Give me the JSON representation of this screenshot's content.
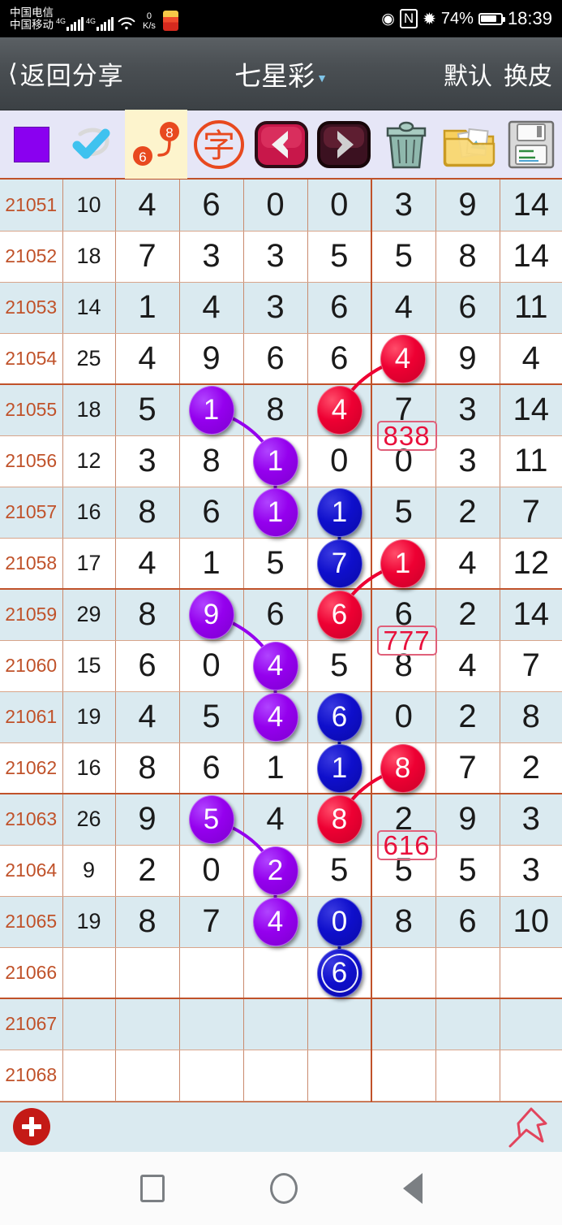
{
  "status_bar": {
    "carrier_top": "中国电信",
    "carrier_bottom": "中国移动",
    "net_label_1": "4G",
    "net_label_2": "4G",
    "speed_value": "0",
    "speed_unit": "K/s",
    "battery": "74%",
    "time": "18:39"
  },
  "header": {
    "back_label": "返回分享",
    "title": "七星彩",
    "right_1": "默认",
    "right_2": "换皮"
  },
  "toolbar": {
    "items": [
      {
        "name": "color-swatch",
        "label": "",
        "color": "#8a00f0"
      },
      {
        "name": "check-pen-icon",
        "label": ""
      },
      {
        "name": "connect-numbers-icon",
        "label_top": "8",
        "label_bottom": "6"
      },
      {
        "name": "chinese-character-icon",
        "label": "字"
      },
      {
        "name": "prev-arrow-icon",
        "label": ""
      },
      {
        "name": "next-arrow-icon",
        "label": ""
      },
      {
        "name": "trash-icon",
        "label": ""
      },
      {
        "name": "folder-photos-icon",
        "label": ""
      },
      {
        "name": "floppy-save-icon",
        "label": ""
      }
    ]
  },
  "table": {
    "rows": [
      {
        "period": "21051",
        "sum": "10",
        "digits": [
          "4",
          "6",
          "0",
          "0",
          "3",
          "9",
          "14"
        ]
      },
      {
        "period": "21052",
        "sum": "18",
        "digits": [
          "7",
          "3",
          "3",
          "5",
          "5",
          "8",
          "14"
        ]
      },
      {
        "period": "21053",
        "sum": "14",
        "digits": [
          "1",
          "4",
          "3",
          "6",
          "4",
          "6",
          "11"
        ]
      },
      {
        "period": "21054",
        "sum": "25",
        "digits": [
          "4",
          "9",
          "6",
          "6",
          "4",
          "9",
          "4"
        ]
      },
      {
        "period": "21055",
        "sum": "18",
        "digits": [
          "5",
          "1",
          "8",
          "4",
          "7",
          "3",
          "14"
        ]
      },
      {
        "period": "21056",
        "sum": "12",
        "digits": [
          "3",
          "8",
          "1",
          "0",
          "0",
          "3",
          "11"
        ]
      },
      {
        "period": "21057",
        "sum": "16",
        "digits": [
          "8",
          "6",
          "1",
          "1",
          "5",
          "2",
          "7"
        ]
      },
      {
        "period": "21058",
        "sum": "17",
        "digits": [
          "4",
          "1",
          "5",
          "7",
          "1",
          "4",
          "12"
        ]
      },
      {
        "period": "21059",
        "sum": "29",
        "digits": [
          "8",
          "9",
          "6",
          "6",
          "6",
          "2",
          "14"
        ]
      },
      {
        "period": "21060",
        "sum": "15",
        "digits": [
          "6",
          "0",
          "4",
          "5",
          "8",
          "4",
          "7"
        ]
      },
      {
        "period": "21061",
        "sum": "19",
        "digits": [
          "4",
          "5",
          "4",
          "6",
          "0",
          "2",
          "8"
        ]
      },
      {
        "period": "21062",
        "sum": "16",
        "digits": [
          "8",
          "6",
          "1",
          "1",
          "8",
          "7",
          "2"
        ]
      },
      {
        "period": "21063",
        "sum": "26",
        "digits": [
          "9",
          "5",
          "4",
          "8",
          "2",
          "9",
          "3"
        ]
      },
      {
        "period": "21064",
        "sum": "9",
        "digits": [
          "2",
          "0",
          "2",
          "5",
          "5",
          "5",
          "3"
        ]
      },
      {
        "period": "21065",
        "sum": "19",
        "digits": [
          "8",
          "7",
          "4",
          "0",
          "8",
          "6",
          "10"
        ]
      },
      {
        "period": "21066",
        "sum": "",
        "digits": [
          "",
          "",
          "",
          "6",
          "",
          "",
          ""
        ]
      },
      {
        "period": "21067",
        "sum": "",
        "digits": [
          "",
          "",
          "",
          "",
          "",
          "",
          ""
        ]
      },
      {
        "period": "21068",
        "sum": "",
        "digits": [
          "",
          "",
          "",
          "",
          "",
          "",
          ""
        ]
      }
    ],
    "markers": [
      {
        "value": "4",
        "color": "red",
        "row": 3,
        "col": 4,
        "style": "solid"
      },
      {
        "value": "1",
        "color": "purple",
        "row": 4,
        "col": 1,
        "style": "solid"
      },
      {
        "value": "4",
        "color": "red",
        "row": 4,
        "col": 3,
        "style": "solid"
      },
      {
        "value": "1",
        "color": "purple",
        "row": 5,
        "col": 2,
        "style": "solid"
      },
      {
        "value": "1",
        "color": "purple",
        "row": 6,
        "col": 2,
        "style": "solid"
      },
      {
        "value": "1",
        "color": "blue",
        "row": 6,
        "col": 3,
        "style": "solid"
      },
      {
        "value": "7",
        "color": "blue",
        "row": 7,
        "col": 3,
        "style": "solid"
      },
      {
        "value": "1",
        "color": "red",
        "row": 7,
        "col": 4,
        "style": "solid"
      },
      {
        "value": "9",
        "color": "purple",
        "row": 8,
        "col": 1,
        "style": "solid"
      },
      {
        "value": "6",
        "color": "red",
        "row": 8,
        "col": 3,
        "style": "solid"
      },
      {
        "value": "4",
        "color": "purple",
        "row": 9,
        "col": 2,
        "style": "solid"
      },
      {
        "value": "4",
        "color": "purple",
        "row": 10,
        "col": 2,
        "style": "solid"
      },
      {
        "value": "6",
        "color": "blue",
        "row": 10,
        "col": 3,
        "style": "solid"
      },
      {
        "value": "1",
        "color": "blue",
        "row": 11,
        "col": 3,
        "style": "solid"
      },
      {
        "value": "8",
        "color": "red",
        "row": 11,
        "col": 4,
        "style": "solid"
      },
      {
        "value": "5",
        "color": "purple",
        "row": 12,
        "col": 1,
        "style": "solid"
      },
      {
        "value": "8",
        "color": "red",
        "row": 12,
        "col": 3,
        "style": "solid"
      },
      {
        "value": "2",
        "color": "purple",
        "row": 13,
        "col": 2,
        "style": "solid"
      },
      {
        "value": "4",
        "color": "purple",
        "row": 14,
        "col": 2,
        "style": "solid"
      },
      {
        "value": "0",
        "color": "blue",
        "row": 14,
        "col": 3,
        "style": "solid"
      },
      {
        "value": "6",
        "color": "blue",
        "row": 15,
        "col": 3,
        "style": "ring"
      }
    ],
    "tags": [
      {
        "text": "838",
        "row": 4,
        "col": 5
      },
      {
        "text": "777",
        "row": 8,
        "col": 5
      },
      {
        "text": "616",
        "row": 12,
        "col": 5
      }
    ]
  },
  "footer": {
    "add_button": "add-record",
    "pin_button": "pin-marker"
  },
  "nav_bar": {
    "recent": "recents",
    "home": "home",
    "back": "back"
  },
  "colors": {
    "purple": "#9500ee",
    "blue": "#0f0fcc",
    "red": "#ee0033",
    "tag": "#e8103c",
    "grid_line": "#c0522a",
    "row_alt": "#daeaf0"
  }
}
